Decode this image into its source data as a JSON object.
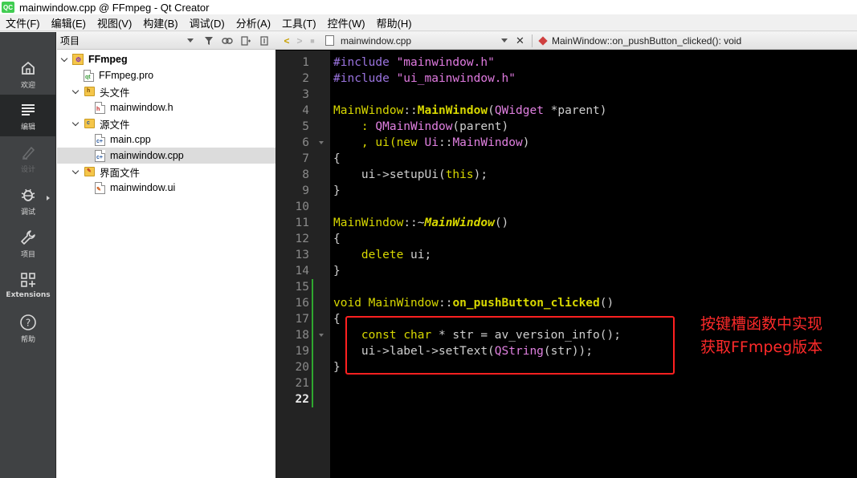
{
  "window": {
    "title": "mainwindow.cpp @ FFmpeg - Qt Creator",
    "logo_text": "QC"
  },
  "menu": [
    "文件(F)",
    "编辑(E)",
    "视图(V)",
    "构建(B)",
    "调试(D)",
    "分析(A)",
    "工具(T)",
    "控件(W)",
    "帮助(H)"
  ],
  "modes": [
    {
      "label": "欢迎",
      "icon": "home-icon"
    },
    {
      "label": "编辑",
      "icon": "edit-icon",
      "active": true
    },
    {
      "label": "设计",
      "icon": "design-icon",
      "disabled": true
    },
    {
      "label": "调试",
      "icon": "debug-icon"
    },
    {
      "label": "项目",
      "icon": "wrench-icon"
    },
    {
      "label": "Extensions",
      "icon": "extensions-icon"
    },
    {
      "label": "帮助",
      "icon": "help-icon"
    }
  ],
  "project": {
    "header": "项目",
    "tree": [
      {
        "label": "FFmpeg",
        "icon": "project-icon",
        "expanded": true,
        "bold": true
      },
      {
        "label": "FFmpeg.pro",
        "icon": "pro-file-icon"
      },
      {
        "label": "头文件",
        "icon": "header-folder-icon",
        "expanded": true
      },
      {
        "label": "mainwindow.h",
        "icon": "h-file-icon"
      },
      {
        "label": "源文件",
        "icon": "source-folder-icon",
        "expanded": true
      },
      {
        "label": "main.cpp",
        "icon": "cpp-file-icon"
      },
      {
        "label": "mainwindow.cpp",
        "icon": "cpp-file-icon",
        "selected": true
      },
      {
        "label": "界面文件",
        "icon": "forms-folder-icon",
        "expanded": true
      },
      {
        "label": "mainwindow.ui",
        "icon": "ui-file-icon"
      }
    ]
  },
  "editor": {
    "file_name": "mainwindow.cpp",
    "symbol": "MainWindow::on_pushButton_clicked(): void",
    "current_line": "22",
    "line_numbers": [
      "1",
      "2",
      "3",
      "4",
      "5",
      "6",
      "7",
      "8",
      "9",
      "10",
      "11",
      "12",
      "13",
      "14",
      "15",
      "16",
      "17",
      "18",
      "19",
      "20",
      "21",
      "22"
    ],
    "code": {
      "l1a": "#include ",
      "l1b": "\"mainwindow.h\"",
      "l2a": "#include ",
      "l2b": "\"ui_mainwindow.h\"",
      "l4a": "MainWindow",
      "l4b": "::",
      "l4c": "MainWindow",
      "l4d": "(",
      "l4e": "QWidget",
      "l4f": " *parent)",
      "l5a": "    : ",
      "l5b": "QMainWindow",
      "l5c": "(parent)",
      "l6a": "    , ui(",
      "l6b": "new",
      "l6c": " ",
      "l6d": "Ui",
      "l6e": "::",
      "l6f": "MainWindow",
      "l6g": ")",
      "l7": "{",
      "l8a": "    ui->setupUi(",
      "l8b": "this",
      "l8c": ");",
      "l9": "}",
      "l11a": "MainWindow",
      "l11b": "::~",
      "l11c": "MainWindow",
      "l11d": "()",
      "l12": "{",
      "l13a": "    ",
      "l13b": "delete",
      "l13c": " ui;",
      "l14": "}",
      "l16a": "void",
      "l16b": " ",
      "l16c": "MainWindow",
      "l16d": "::",
      "l16e": "on_pushButton_clicked",
      "l16f": "()",
      "l17": "{",
      "l18a": "    ",
      "l18b": "const",
      "l18c": " ",
      "l18d": "char",
      "l18e": " * str = av_version_info();",
      "l19a": "    ui->label->setText(",
      "l19b": "QString",
      "l19c": "(str));",
      "l20": "}"
    }
  },
  "annotation": {
    "line1": "按键槽函数中实现",
    "line2": "获取FFmpeg版本",
    "color": "#ff2a2a"
  }
}
